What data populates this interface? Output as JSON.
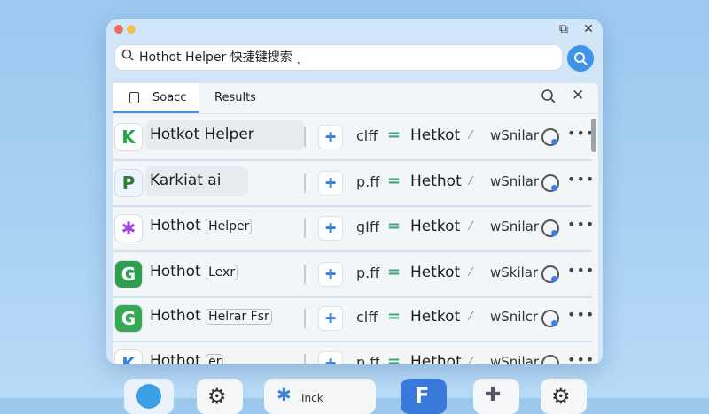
{
  "window": {
    "controls": {
      "restore": "⧉",
      "close": "✕"
    }
  },
  "search": {
    "query": "Hothot Helper 快捷键搜索 ˎ",
    "icon": "search-icon",
    "go_icon": "search-icon",
    "accent": "#3f93e8"
  },
  "tabs": [
    {
      "label": "Soacc",
      "active": true
    },
    {
      "label": "Results",
      "active": false
    }
  ],
  "tab_controls": {
    "search": "⚲",
    "close": "✕"
  },
  "rows": [
    {
      "icon_letter": "K",
      "icon_bg": "#ffffff",
      "icon_color": "#1fa84b",
      "name": "Hotkot Helper",
      "name_tag": "",
      "ext": "clff",
      "hotkey": "Hetkot",
      "similar": "wSnilar"
    },
    {
      "icon_letter": "P",
      "icon_bg": "#eef4ff",
      "icon_color": "#2e7d32",
      "name": "Karkiat ai",
      "name_tag": "",
      "ext": "p.ff",
      "hotkey": "Hethot",
      "similar": "wSnilar"
    },
    {
      "icon_letter": "✱",
      "icon_bg": "#ffffff",
      "icon_color": "#a246e0",
      "name": "Hothot",
      "name_tag": "Helper",
      "ext": "gIff",
      "hotkey": "Hetkot",
      "similar": "wSnilar"
    },
    {
      "icon_letter": "G",
      "icon_bg": "#2e9e4f",
      "icon_color": "#ffffff",
      "name": "Hothot",
      "name_tag": "Lexr",
      "ext": "p.ff",
      "hotkey": "Hetkot",
      "similar": "wSkilar"
    },
    {
      "icon_letter": "G",
      "icon_bg": "#34a853",
      "icon_color": "#ffffff",
      "name": "Hothot",
      "name_tag": "Helrar Fsr",
      "ext": "clff",
      "hotkey": "Hetkot",
      "similar": "wSnilcr"
    },
    {
      "icon_letter": "K",
      "icon_bg": "#ffffff",
      "icon_color": "#3b82d6",
      "name": "Hothot",
      "name_tag": "er",
      "ext": "p.ff",
      "hotkey": "Hethot",
      "similar": "wSnilar"
    }
  ],
  "row_symbols": {
    "equals": "=",
    "pen": "⁄",
    "more": "•••"
  },
  "dock": {
    "items": [
      {
        "icon": "telegram-icon"
      },
      {
        "icon": "gear-icon"
      },
      {
        "icon": "app-icon",
        "label": "Inck"
      },
      {
        "icon": "files-icon"
      },
      {
        "icon": "puzzle-icon"
      },
      {
        "icon": "gear-icon"
      }
    ]
  }
}
